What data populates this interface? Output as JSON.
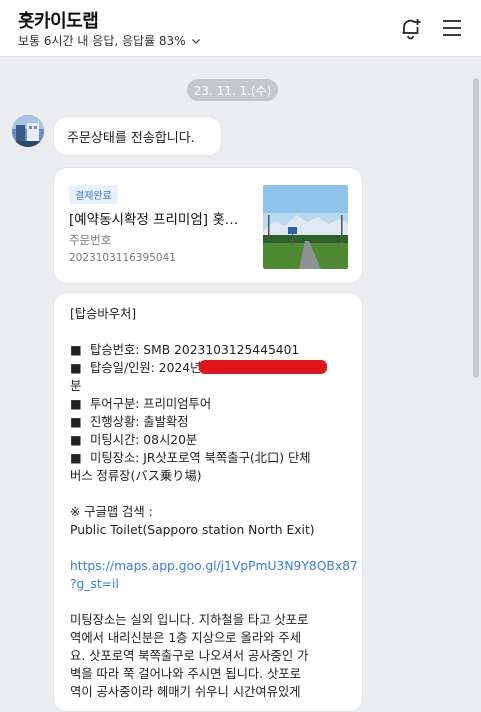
{
  "header": {
    "title": "홋카이도랩",
    "subtitle": "보통 6시간 내 응답, 응답률 83%",
    "icons": [
      "notification-add-icon",
      "menu-icon"
    ]
  },
  "date_divider": "23. 11. 1.(수)",
  "messages": {
    "intro": "주문상태를 전송합니다.",
    "order_card": {
      "badge": "결제완료",
      "title": "[예약동시확정 프리미엄] 홋카이도",
      "order_label": "주문번호",
      "order_number": "2023103116395041"
    },
    "voucher": {
      "heading": "[탑승바우처]",
      "boarding_no": "탑승번호: SMB 2023103125445401",
      "date_people": "탑승일/인원: 2024년",
      "date_people_tail": "분",
      "tour_type": "투어구분: 프리미엄투어",
      "status": "진행상황: 출발확정",
      "meeting_time": "미팅시간: 08시20분",
      "meeting_place_1": "미팅장소: JR삿포로역 북쪽출구(北口) 단체",
      "meeting_place_2": "버스 정류장(バス乗り場)",
      "google_map_label": "※ 구글맵 검색 :",
      "google_map_query": "Public Toilet(Sapporo station North Exit)",
      "map_link_1": "https://maps.app.goo.gl/j1VpPmU3N9Y8QBx87",
      "map_link_2": "?g_st=il",
      "note_1": "미팅장소는 실외 입니다. 지하철을 타고 삿포로",
      "note_2": "역에서 내리신분은 1층 지상으로 올라와 주세",
      "note_3": "요. 삿포로역 북쪽출구로 나오셔서 공사중인 가",
      "note_4": "벽을 따라 쭉 걸어나와 주시면 됩니다. 삿포로",
      "note_5": "역이 공사중이라 헤매기 쉬우니 시간여유있게"
    }
  }
}
